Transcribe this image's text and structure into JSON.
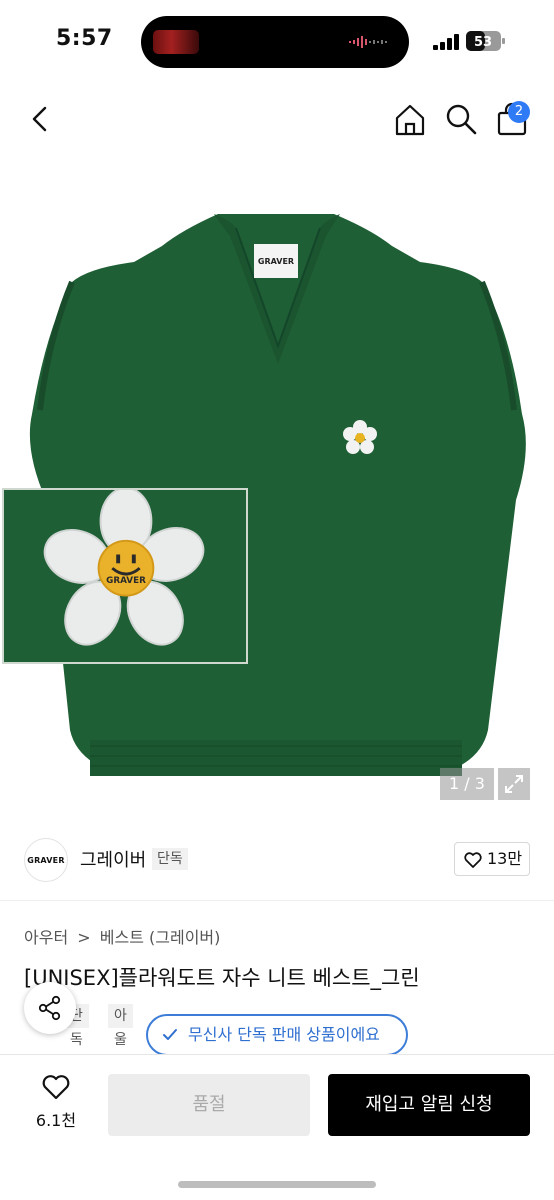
{
  "status_bar": {
    "time": "5:57",
    "battery": "53"
  },
  "nav": {
    "cart_count": "2"
  },
  "hero": {
    "pager": "1 / 3",
    "patch_text": "GRAVER",
    "label_text": "GRAVER"
  },
  "brand": {
    "logo_text": "GRAVER",
    "name": "그레이버",
    "tag": "단독",
    "likes": "13만"
  },
  "product": {
    "breadcrumb": [
      "아우터",
      ">",
      "베스트 (그레이버)"
    ],
    "title": "[UNISEX]플라워도트 자수 니트 베스트_그린",
    "tags": [
      "단독",
      "아울렛"
    ]
  },
  "toast": {
    "text": "무신사 단독 판매 상품이에요"
  },
  "bottom_bar": {
    "wish_count": "6.1천",
    "soldout_label": "품절",
    "restock_label": "재입고 알림 신청"
  },
  "colors": {
    "vest_green": "#1f5f35",
    "accent_blue": "#2f7bf5",
    "toast_blue": "#3d7dd8"
  }
}
